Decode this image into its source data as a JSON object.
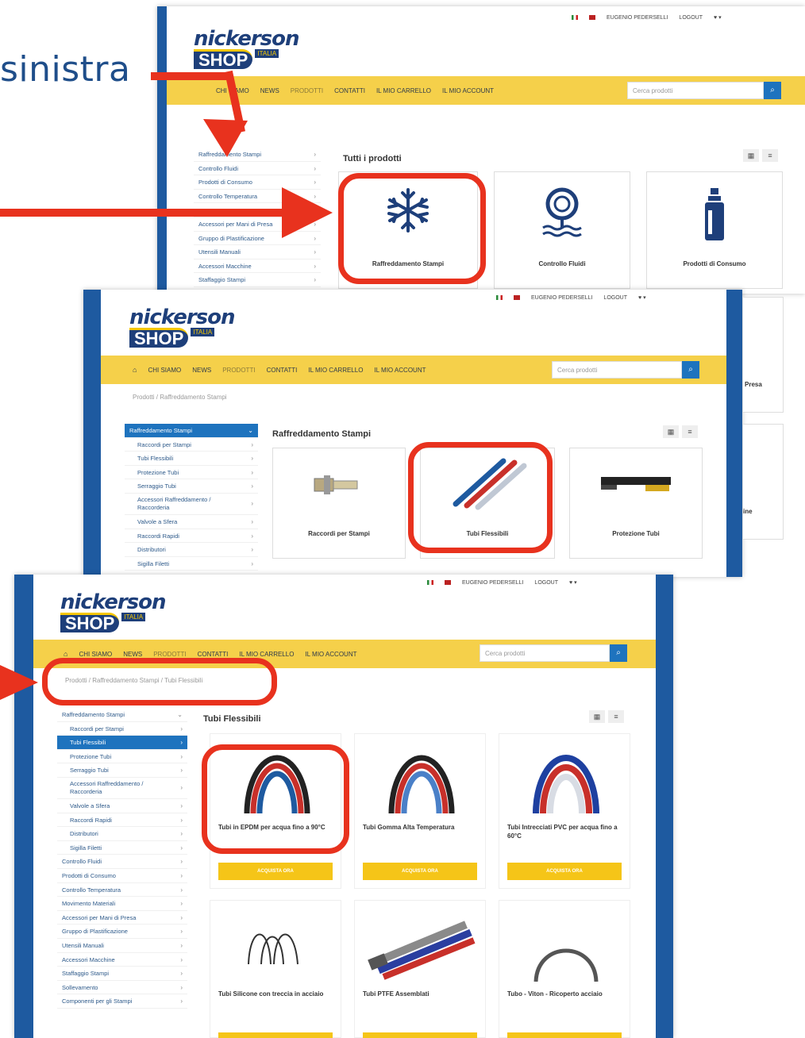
{
  "annotation": {
    "word": "sinistra"
  },
  "common": {
    "brand": "nickerson",
    "shop": "SHOP",
    "italia": "ITALIA",
    "user": "EUGENIO PEDERSELLI",
    "logout": "LOGOUT",
    "nav": [
      "CHI SIAMO",
      "NEWS",
      "PRODOTTI",
      "CONTATTI",
      "IL MIO CARRELLO",
      "IL MIO ACCOUNT"
    ],
    "search_placeholder": "Cerca prodotti",
    "colors": {
      "yellow_nav": "#f5d04a",
      "blue": "#1e73be",
      "red_highlight": "#e8321e",
      "dark_blue": "#1e3f7a"
    }
  },
  "screen1": {
    "title": "Tutti i prodotti",
    "sidebar": [
      "Raffreddamento Stampi",
      "Controllo Fluidi",
      "Prodotti di Consumo",
      "Controllo Temperatura",
      "",
      "Accessori per Mani di Presa",
      "Gruppo di Plastificazione",
      "Utensili Manuali",
      "Accessori Macchine",
      "Staffaggio Stampi"
    ],
    "cards": [
      {
        "label": "Raffreddamento Stampi",
        "icon": "snowflake-icon"
      },
      {
        "label": "Controllo Fluidi",
        "icon": "gauge-icon"
      },
      {
        "label": "Prodotti di Consumo",
        "icon": "bottle-icon"
      }
    ]
  },
  "screen2": {
    "breadcrumb": "Prodotti  /  Raffreddamento Stampi",
    "title": "Raffreddamento Stampi",
    "peek_label_1": "Presa",
    "peek_label_2": "ine",
    "sidebar": [
      {
        "label": "Raffreddamento Stampi",
        "active": true
      },
      {
        "label": "Raccordi per Stampi"
      },
      {
        "label": "Tubi Flessibili"
      },
      {
        "label": "Protezione Tubi"
      },
      {
        "label": "Serraggio Tubi"
      },
      {
        "label": "Accessori Raffreddamento / Raccorderia",
        "two": true
      },
      {
        "label": "Valvole a Sfera"
      },
      {
        "label": "Raccordi Rapidi"
      },
      {
        "label": "Distributori"
      },
      {
        "label": "Sigilla Filetti"
      }
    ],
    "cards": [
      {
        "label": "Raccordi per Stampi",
        "icon": "fitting-icon"
      },
      {
        "label": "Tubi Flessibili",
        "icon": "hoses-icon"
      },
      {
        "label": "Protezione Tubi",
        "icon": "hose-protection-icon"
      }
    ]
  },
  "screen3": {
    "breadcrumb": "Prodotti  /  Raffreddamento Stampi  /  Tubi Flessibili",
    "title": "Tubi Flessibili",
    "sidebar": [
      {
        "label": "Raffreddamento Stampi"
      },
      {
        "label": "Raccordi per Stampi",
        "sub": true
      },
      {
        "label": "Tubi Flessibili",
        "sub": true,
        "active": true
      },
      {
        "label": "Protezione Tubi",
        "sub": true
      },
      {
        "label": "Serraggio Tubi",
        "sub": true
      },
      {
        "label": "Accessori Raffreddamento / Raccorderia",
        "sub": true,
        "two": true
      },
      {
        "label": "Valvole a Sfera",
        "sub": true
      },
      {
        "label": "Raccordi Rapidi",
        "sub": true
      },
      {
        "label": "Distributori",
        "sub": true
      },
      {
        "label": "Sigilla Filetti",
        "sub": true
      },
      {
        "label": "Controllo Fluidi"
      },
      {
        "label": "Prodotti di Consumo"
      },
      {
        "label": "Controllo Temperatura"
      },
      {
        "label": "Movimento Materiali"
      },
      {
        "label": "Accessori per Mani di Presa"
      },
      {
        "label": "Gruppo di Plastificazione"
      },
      {
        "label": "Utensili Manuali"
      },
      {
        "label": "Accessori Macchine"
      },
      {
        "label": "Staffaggio Stampi"
      },
      {
        "label": "Sollevamento"
      },
      {
        "label": "Componenti per gli Stampi"
      }
    ],
    "products": [
      {
        "name": "Tubi in EPDM per acqua fino a 90°C",
        "button": "Acquista ora"
      },
      {
        "name": "Tubi Gomma Alta Temperatura",
        "button": "Acquista ora"
      },
      {
        "name": "Tubi Intrecciati PVC per acqua fino a 60°C",
        "button": "Acquista ora"
      },
      {
        "name": "Tubi Silicone con treccia in acciaio",
        "button": ""
      },
      {
        "name": "Tubi PTFE Assemblati",
        "button": ""
      },
      {
        "name": "Tubo - Viton - Ricoperto acciaio",
        "button": ""
      }
    ]
  }
}
